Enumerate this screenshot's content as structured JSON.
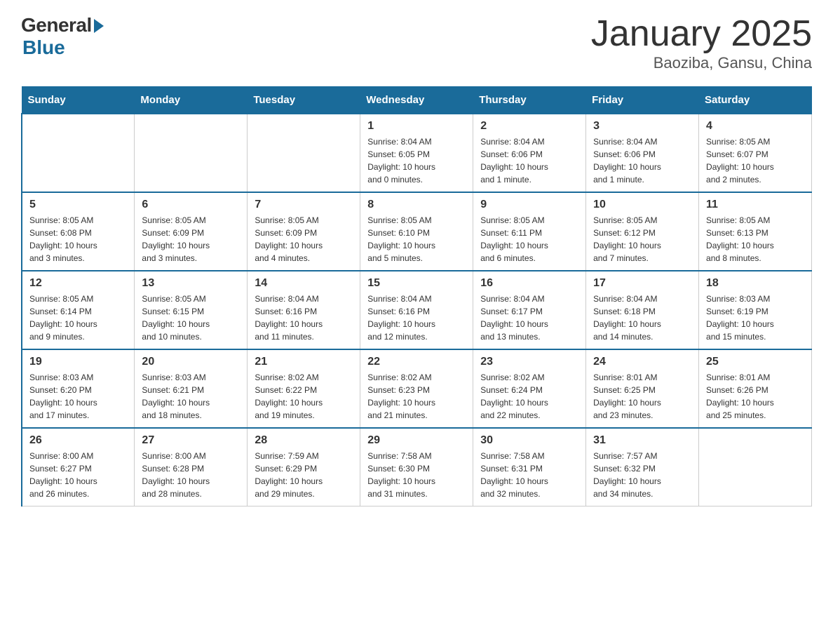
{
  "header": {
    "logo_general": "General",
    "logo_blue": "Blue",
    "title": "January 2025",
    "subtitle": "Baoziba, Gansu, China"
  },
  "days_of_week": [
    "Sunday",
    "Monday",
    "Tuesday",
    "Wednesday",
    "Thursday",
    "Friday",
    "Saturday"
  ],
  "weeks": [
    [
      {
        "num": "",
        "info": ""
      },
      {
        "num": "",
        "info": ""
      },
      {
        "num": "",
        "info": ""
      },
      {
        "num": "1",
        "info": "Sunrise: 8:04 AM\nSunset: 6:05 PM\nDaylight: 10 hours\nand 0 minutes."
      },
      {
        "num": "2",
        "info": "Sunrise: 8:04 AM\nSunset: 6:06 PM\nDaylight: 10 hours\nand 1 minute."
      },
      {
        "num": "3",
        "info": "Sunrise: 8:04 AM\nSunset: 6:06 PM\nDaylight: 10 hours\nand 1 minute."
      },
      {
        "num": "4",
        "info": "Sunrise: 8:05 AM\nSunset: 6:07 PM\nDaylight: 10 hours\nand 2 minutes."
      }
    ],
    [
      {
        "num": "5",
        "info": "Sunrise: 8:05 AM\nSunset: 6:08 PM\nDaylight: 10 hours\nand 3 minutes."
      },
      {
        "num": "6",
        "info": "Sunrise: 8:05 AM\nSunset: 6:09 PM\nDaylight: 10 hours\nand 3 minutes."
      },
      {
        "num": "7",
        "info": "Sunrise: 8:05 AM\nSunset: 6:09 PM\nDaylight: 10 hours\nand 4 minutes."
      },
      {
        "num": "8",
        "info": "Sunrise: 8:05 AM\nSunset: 6:10 PM\nDaylight: 10 hours\nand 5 minutes."
      },
      {
        "num": "9",
        "info": "Sunrise: 8:05 AM\nSunset: 6:11 PM\nDaylight: 10 hours\nand 6 minutes."
      },
      {
        "num": "10",
        "info": "Sunrise: 8:05 AM\nSunset: 6:12 PM\nDaylight: 10 hours\nand 7 minutes."
      },
      {
        "num": "11",
        "info": "Sunrise: 8:05 AM\nSunset: 6:13 PM\nDaylight: 10 hours\nand 8 minutes."
      }
    ],
    [
      {
        "num": "12",
        "info": "Sunrise: 8:05 AM\nSunset: 6:14 PM\nDaylight: 10 hours\nand 9 minutes."
      },
      {
        "num": "13",
        "info": "Sunrise: 8:05 AM\nSunset: 6:15 PM\nDaylight: 10 hours\nand 10 minutes."
      },
      {
        "num": "14",
        "info": "Sunrise: 8:04 AM\nSunset: 6:16 PM\nDaylight: 10 hours\nand 11 minutes."
      },
      {
        "num": "15",
        "info": "Sunrise: 8:04 AM\nSunset: 6:16 PM\nDaylight: 10 hours\nand 12 minutes."
      },
      {
        "num": "16",
        "info": "Sunrise: 8:04 AM\nSunset: 6:17 PM\nDaylight: 10 hours\nand 13 minutes."
      },
      {
        "num": "17",
        "info": "Sunrise: 8:04 AM\nSunset: 6:18 PM\nDaylight: 10 hours\nand 14 minutes."
      },
      {
        "num": "18",
        "info": "Sunrise: 8:03 AM\nSunset: 6:19 PM\nDaylight: 10 hours\nand 15 minutes."
      }
    ],
    [
      {
        "num": "19",
        "info": "Sunrise: 8:03 AM\nSunset: 6:20 PM\nDaylight: 10 hours\nand 17 minutes."
      },
      {
        "num": "20",
        "info": "Sunrise: 8:03 AM\nSunset: 6:21 PM\nDaylight: 10 hours\nand 18 minutes."
      },
      {
        "num": "21",
        "info": "Sunrise: 8:02 AM\nSunset: 6:22 PM\nDaylight: 10 hours\nand 19 minutes."
      },
      {
        "num": "22",
        "info": "Sunrise: 8:02 AM\nSunset: 6:23 PM\nDaylight: 10 hours\nand 21 minutes."
      },
      {
        "num": "23",
        "info": "Sunrise: 8:02 AM\nSunset: 6:24 PM\nDaylight: 10 hours\nand 22 minutes."
      },
      {
        "num": "24",
        "info": "Sunrise: 8:01 AM\nSunset: 6:25 PM\nDaylight: 10 hours\nand 23 minutes."
      },
      {
        "num": "25",
        "info": "Sunrise: 8:01 AM\nSunset: 6:26 PM\nDaylight: 10 hours\nand 25 minutes."
      }
    ],
    [
      {
        "num": "26",
        "info": "Sunrise: 8:00 AM\nSunset: 6:27 PM\nDaylight: 10 hours\nand 26 minutes."
      },
      {
        "num": "27",
        "info": "Sunrise: 8:00 AM\nSunset: 6:28 PM\nDaylight: 10 hours\nand 28 minutes."
      },
      {
        "num": "28",
        "info": "Sunrise: 7:59 AM\nSunset: 6:29 PM\nDaylight: 10 hours\nand 29 minutes."
      },
      {
        "num": "29",
        "info": "Sunrise: 7:58 AM\nSunset: 6:30 PM\nDaylight: 10 hours\nand 31 minutes."
      },
      {
        "num": "30",
        "info": "Sunrise: 7:58 AM\nSunset: 6:31 PM\nDaylight: 10 hours\nand 32 minutes."
      },
      {
        "num": "31",
        "info": "Sunrise: 7:57 AM\nSunset: 6:32 PM\nDaylight: 10 hours\nand 34 minutes."
      },
      {
        "num": "",
        "info": ""
      }
    ]
  ]
}
